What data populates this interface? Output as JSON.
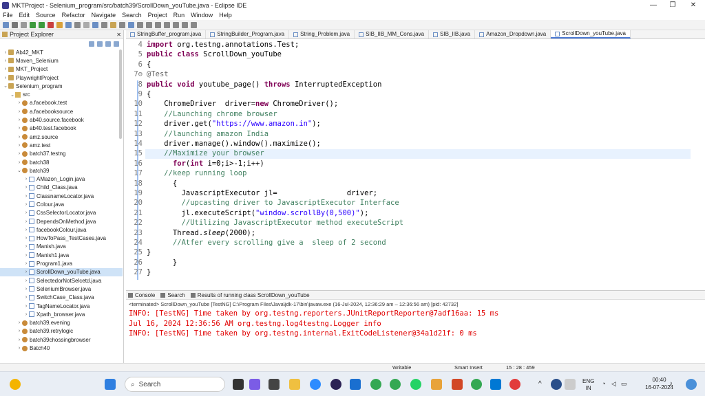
{
  "window": {
    "title": "MKTProject - Selenium_program/src/batch39/ScrollDown_youTube.java - Eclipse IDE"
  },
  "menu": [
    "File",
    "Edit",
    "Source",
    "Refactor",
    "Navigate",
    "Search",
    "Project",
    "Run",
    "Window",
    "Help"
  ],
  "project_explorer": {
    "title": "Project Explorer",
    "items": [
      {
        "label": "Ab42_MKT",
        "type": "proj",
        "indent": 0,
        "arrow": "›"
      },
      {
        "label": "Maven_Selenium",
        "type": "proj",
        "indent": 0,
        "arrow": "›"
      },
      {
        "label": "MKT_Project",
        "type": "proj",
        "indent": 0,
        "arrow": "›"
      },
      {
        "label": "PlaywrightProject",
        "type": "proj",
        "indent": 0,
        "arrow": "›"
      },
      {
        "label": "Selenium_program",
        "type": "proj",
        "indent": 0,
        "arrow": "⌄"
      },
      {
        "label": "src",
        "type": "folder",
        "indent": 1,
        "arrow": "⌄"
      },
      {
        "label": "a.facebook.test",
        "type": "pkg",
        "indent": 2,
        "arrow": "›"
      },
      {
        "label": "a.facebooksource",
        "type": "pkg",
        "indent": 2,
        "arrow": "›"
      },
      {
        "label": "ab40.source.facebook",
        "type": "pkg",
        "indent": 2,
        "arrow": "›"
      },
      {
        "label": "ab40.test.facebook",
        "type": "pkg",
        "indent": 2,
        "arrow": "›"
      },
      {
        "label": "amz.source",
        "type": "pkg",
        "indent": 2,
        "arrow": "›"
      },
      {
        "label": "amz.test",
        "type": "pkg",
        "indent": 2,
        "arrow": "›"
      },
      {
        "label": "batch37.testng",
        "type": "pkg",
        "indent": 2,
        "arrow": "›"
      },
      {
        "label": "batch38",
        "type": "pkg",
        "indent": 2,
        "arrow": "›"
      },
      {
        "label": "batch39",
        "type": "pkg",
        "indent": 2,
        "arrow": "⌄"
      },
      {
        "label": "AMazon_Login.java",
        "type": "java",
        "indent": 3,
        "arrow": "›"
      },
      {
        "label": "Child_Class.java",
        "type": "java",
        "indent": 3,
        "arrow": "›"
      },
      {
        "label": "ClassnameLocator.java",
        "type": "java",
        "indent": 3,
        "arrow": "›"
      },
      {
        "label": "Colour.java",
        "type": "java",
        "indent": 3,
        "arrow": "›"
      },
      {
        "label": "CssSelectorLocator.java",
        "type": "java",
        "indent": 3,
        "arrow": "›"
      },
      {
        "label": "DependsOnMethod.java",
        "type": "java",
        "indent": 3,
        "arrow": "›"
      },
      {
        "label": "facebookColour.java",
        "type": "java",
        "indent": 3,
        "arrow": "›"
      },
      {
        "label": "HowToPass_TestCases.java",
        "type": "java",
        "indent": 3,
        "arrow": "›"
      },
      {
        "label": "Manish.java",
        "type": "java",
        "indent": 3,
        "arrow": "›"
      },
      {
        "label": "Manish1.java",
        "type": "java",
        "indent": 3,
        "arrow": "›"
      },
      {
        "label": "Program1.java",
        "type": "java",
        "indent": 3,
        "arrow": "›"
      },
      {
        "label": "ScrollDown_youTube.java",
        "type": "java",
        "indent": 3,
        "arrow": "›",
        "selected": true
      },
      {
        "label": "SelectedorNotSelcetd.java",
        "type": "java",
        "indent": 3,
        "arrow": "›"
      },
      {
        "label": "SeleniumBrowser.java",
        "type": "java",
        "indent": 3,
        "arrow": "›"
      },
      {
        "label": "SwitchCase_Class.java",
        "type": "java",
        "indent": 3,
        "arrow": "›"
      },
      {
        "label": "TagNameLocator.java",
        "type": "java",
        "indent": 3,
        "arrow": "›"
      },
      {
        "label": "Xpath_browser.java",
        "type": "java",
        "indent": 3,
        "arrow": "›"
      },
      {
        "label": "batch39.evening",
        "type": "pkg",
        "indent": 2,
        "arrow": "›"
      },
      {
        "label": "batch39.retrylogic",
        "type": "pkg",
        "indent": 2,
        "arrow": "›"
      },
      {
        "label": "batch39chossingbrowser",
        "type": "pkg",
        "indent": 2,
        "arrow": "›"
      },
      {
        "label": "Batch40",
        "type": "pkg",
        "indent": 2,
        "arrow": "›"
      }
    ]
  },
  "editor_tabs": [
    {
      "label": "StringBuffer_program.java"
    },
    {
      "label": "StringBuilder_Program.java"
    },
    {
      "label": "String_Problem.java"
    },
    {
      "label": "SIB_IIB_MM_Cons.java"
    },
    {
      "label": "SIB_IIB.java"
    },
    {
      "label": "Amazon_Dropdown.java"
    },
    {
      "label": "ScrollDown_youTube.java",
      "active": true
    }
  ],
  "code_lines": [
    {
      "n": "4",
      "html": "<span class='kw'>import</span> org.testng.annotations.Test;"
    },
    {
      "n": "5",
      "html": "<span class='kw'>public class</span> ScrollDown_youTube"
    },
    {
      "n": "6",
      "html": "{"
    },
    {
      "n": "7⊖",
      "html": "<span style='color:#646464'>@Test</span>"
    },
    {
      "n": "8",
      "html": "<span class='kw'>public void</span> youtube_page() <span class='kw'>throws</span> InterruptedException"
    },
    {
      "n": "9",
      "html": "{"
    },
    {
      "n": "10",
      "html": "    ChromeDriver  driver=<span class='kw'>new</span> ChromeDriver();"
    },
    {
      "n": "11",
      "html": "    <span class='cm'>//Launching chrome browser</span>"
    },
    {
      "n": "12",
      "html": "    driver.get(<span class='st'>\"https://www.amazon.in\"</span>);"
    },
    {
      "n": "13",
      "html": "    <span class='cm'>//launching amazon India</span>"
    },
    {
      "n": "14",
      "html": "    driver.manage().window().maximize();"
    },
    {
      "n": "15",
      "html": "    <span class='cm'>//Maximize your browser</span>",
      "current": true
    },
    {
      "n": "16",
      "html": "      <span class='kw'>for</span>(<span class='kw'>int</span> i=0;i>-1;i++)"
    },
    {
      "n": "17",
      "html": "    <span class='cm'>//keep running loop</span>"
    },
    {
      "n": "18",
      "html": "      {"
    },
    {
      "n": "19",
      "html": "        JavascriptExecutor jl=                driver;"
    },
    {
      "n": "20",
      "html": "        <span class='cm'>//upcasting driver to JavascriptExecutor Interface</span>"
    },
    {
      "n": "21",
      "html": "        jl.executeScript(<span class='st'>\"window.scrollBy(0,500)\"</span>);"
    },
    {
      "n": "22",
      "html": "        <span class='cm'>//Utilizing JavascriptExecutor method executeScript</span>"
    },
    {
      "n": "23",
      "html": "      Thread.<span class='it'>sleep</span>(2000);"
    },
    {
      "n": "24",
      "html": "      <span class='cm'>//Atfer every scrolling give a  sleep of 2 second</span>"
    },
    {
      "n": "25",
      "html": "}"
    },
    {
      "n": "26",
      "html": "      }"
    },
    {
      "n": "27",
      "html": "}"
    }
  ],
  "bottom_panel": {
    "tabs": [
      "Console",
      "Search",
      "Results of running class ScrollDown_youTube"
    ],
    "terminated": "<terminated> ScrollDown_youTube [TestNG] C:\\Program Files\\Java\\jdk-17\\bin\\javaw.exe  (16-Jul-2024, 12:36:29 am – 12:36:56 am) [pid: 42732]",
    "lines": [
      "INFO: [TestNG] Time taken by org.testng.reporters.JUnitReportReporter@7adf16aa: 15 ms",
      "Jul 16, 2024 12:36:56 AM org.testng.log4testng.Logger info",
      "INFO: [TestNG] Time taken by org.testng.internal.ExitCodeListener@34a1d21f: 0 ms"
    ]
  },
  "status": {
    "writable": "Writable",
    "insert": "Smart Insert",
    "position": "15 : 28 : 459"
  },
  "taskbar": {
    "search": "Search",
    "lang1": "ENG",
    "lang2": "IN",
    "time": "00:40",
    "date": "16-07-2024"
  }
}
